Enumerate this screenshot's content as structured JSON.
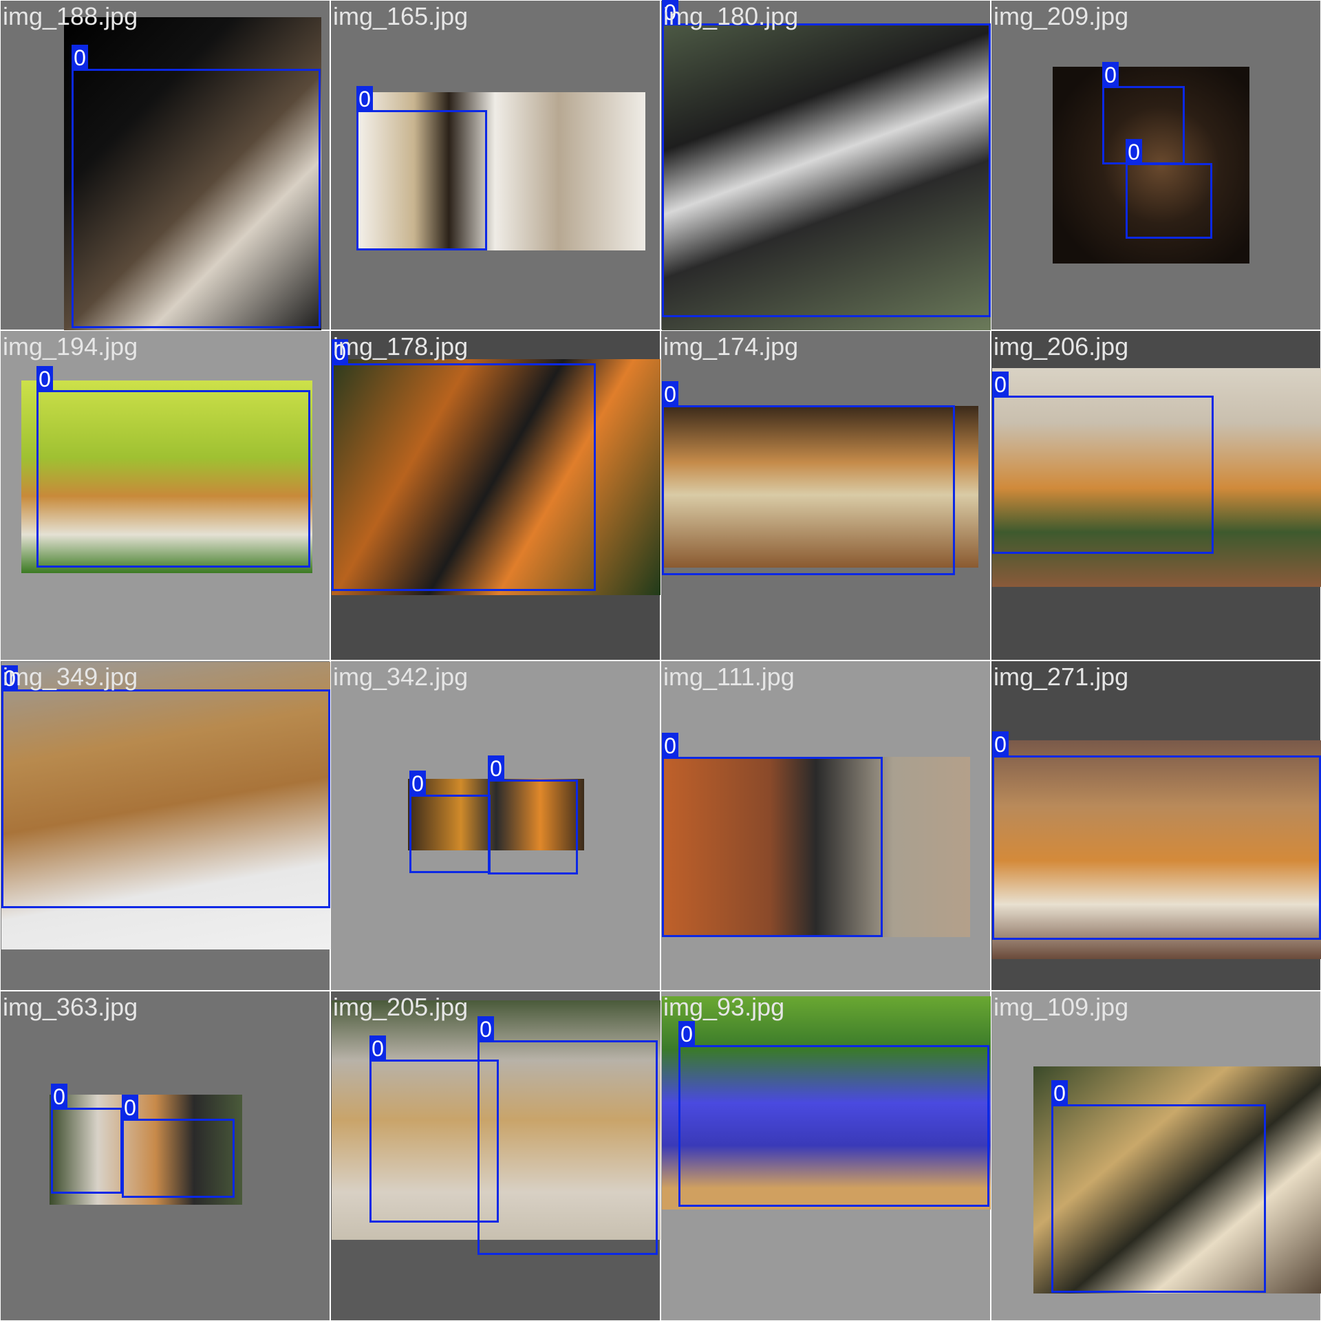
{
  "colors": {
    "bbox": "#0b28e6",
    "label_text": "#e6e6e6"
  },
  "tiles": [
    {
      "label": "img_188.jpg",
      "boxes": [
        {
          "class": "0"
        }
      ]
    },
    {
      "label": "img_165.jpg",
      "boxes": [
        {
          "class": "0"
        }
      ]
    },
    {
      "label": "img_180.jpg",
      "boxes": [
        {
          "class": "0"
        }
      ]
    },
    {
      "label": "img_209.jpg",
      "boxes": [
        {
          "class": "0"
        },
        {
          "class": "0"
        }
      ]
    },
    {
      "label": "img_194.jpg",
      "boxes": [
        {
          "class": "0"
        }
      ]
    },
    {
      "label": "img_178.jpg",
      "boxes": [
        {
          "class": "0"
        }
      ]
    },
    {
      "label": "img_174.jpg",
      "boxes": [
        {
          "class": "0"
        }
      ]
    },
    {
      "label": "img_206.jpg",
      "boxes": [
        {
          "class": "0"
        }
      ]
    },
    {
      "label": "img_349.jpg",
      "boxes": [
        {
          "class": "0"
        }
      ]
    },
    {
      "label": "img_342.jpg",
      "boxes": [
        {
          "class": "0"
        },
        {
          "class": "0"
        }
      ]
    },
    {
      "label": "img_111.jpg",
      "boxes": [
        {
          "class": "0"
        }
      ]
    },
    {
      "label": "img_271.jpg",
      "boxes": [
        {
          "class": "0"
        }
      ]
    },
    {
      "label": "img_363.jpg",
      "boxes": [
        {
          "class": "0"
        },
        {
          "class": "0"
        }
      ]
    },
    {
      "label": "img_205.jpg",
      "boxes": [
        {
          "class": "0"
        },
        {
          "class": "0"
        }
      ]
    },
    {
      "label": "img_93.jpg",
      "boxes": [
        {
          "class": "0"
        }
      ]
    },
    {
      "label": "img_109.jpg",
      "boxes": [
        {
          "class": "0"
        }
      ]
    }
  ]
}
